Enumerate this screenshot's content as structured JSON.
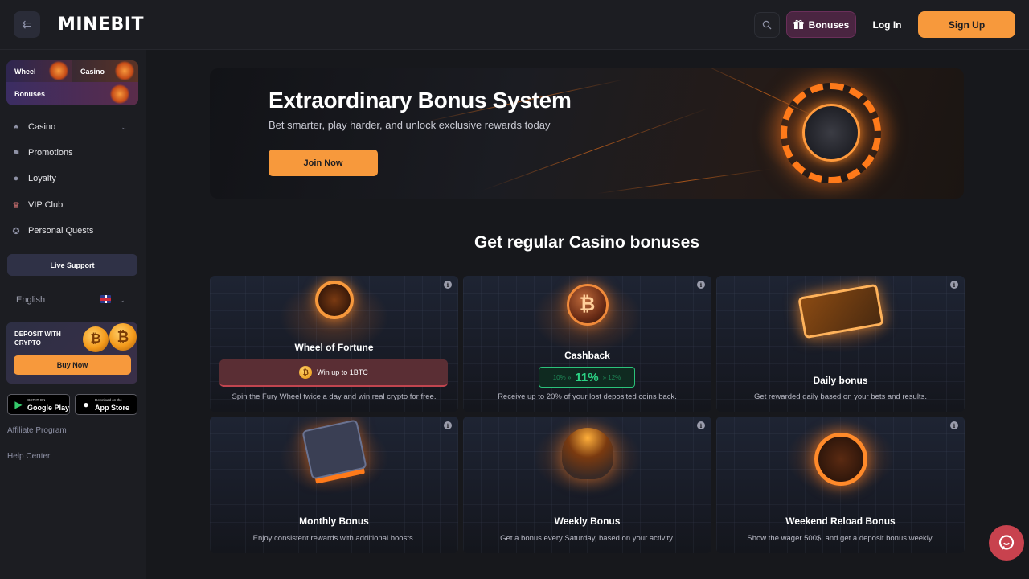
{
  "header": {
    "logo": "MINEBIT",
    "bonuses_label": "Bonuses",
    "login_label": "Log In",
    "signup_label": "Sign Up"
  },
  "sidebar": {
    "tiles": {
      "wheel": "Wheel",
      "casino": "Casino",
      "bonuses": "Bonuses"
    },
    "items": [
      {
        "label": "Casino",
        "icon": "spade-icon"
      },
      {
        "label": "Promotions",
        "icon": "flag-icon"
      },
      {
        "label": "Loyalty",
        "icon": "medal-icon"
      },
      {
        "label": "VIP Club",
        "icon": "crown-icon"
      },
      {
        "label": "Personal Quests",
        "icon": "quest-icon"
      }
    ],
    "live_support": "Live Support",
    "language": "English",
    "deposit": {
      "title": "DEPOSIT WITH CRYPTO",
      "button": "Buy Now"
    },
    "stores": {
      "google": {
        "small": "GET IT ON",
        "big": "Google Play"
      },
      "apple": {
        "small": "Download on the",
        "big": "App Store"
      }
    },
    "links": [
      "Affiliate Program",
      "Help Center"
    ]
  },
  "hero": {
    "title": "Extraordinary Bonus System",
    "subtitle": "Bet smarter, play harder, and unlock exclusive rewards today",
    "button": "Join Now"
  },
  "section_title": "Get regular Casino bonuses",
  "cards": [
    {
      "title": "Wheel of Fortune",
      "desc": "Spin the Fury Wheel twice a day and win real crypto for free.",
      "pill": "Win up to 1BTC"
    },
    {
      "title": "Cashback",
      "desc": "Receive up to 20% of your lost deposited coins back.",
      "pill_left": "10% »",
      "pill_mid": "11%",
      "pill_right": "» 12%"
    },
    {
      "title": "Daily bonus",
      "desc": "Get rewarded daily based on your bets and results."
    },
    {
      "title": "Monthly Bonus",
      "desc": "Enjoy consistent rewards with additional boosts."
    },
    {
      "title": "Weekly Bonus",
      "desc": "Get a bonus every Saturday, based on your activity."
    },
    {
      "title": "Weekend Reload Bonus",
      "desc": "Show the wager 500$, and get a deposit bonus weekly."
    }
  ],
  "colors": {
    "accent": "#f7993c",
    "background": "#17181c",
    "sidebar": "#1c1d22",
    "cashback_green": "#2bd384"
  }
}
